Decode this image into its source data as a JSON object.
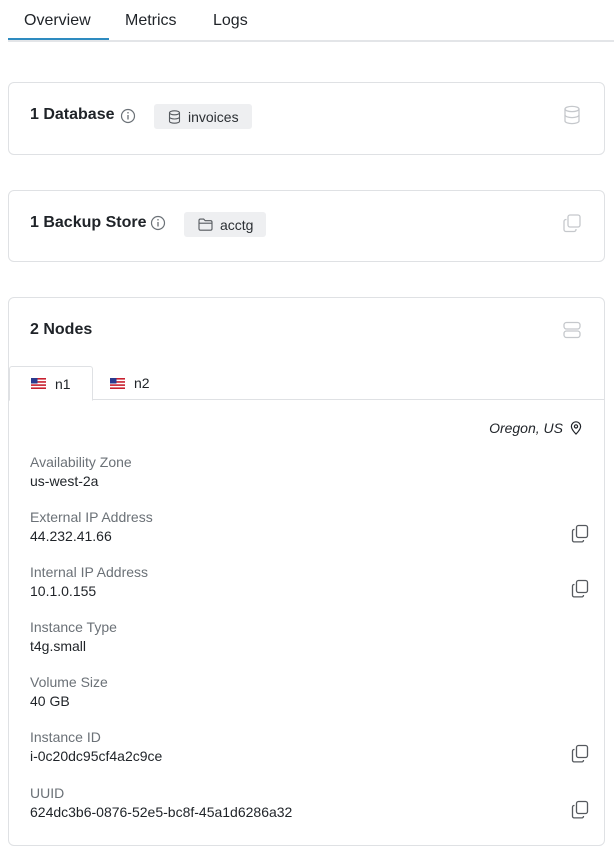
{
  "tabs": [
    {
      "label": "Overview",
      "active": true
    },
    {
      "label": "Metrics",
      "active": false
    },
    {
      "label": "Logs",
      "active": false
    }
  ],
  "colors": {
    "accent": "#2e8bc0",
    "border": "#dfe1e4",
    "muted": "#6b7177",
    "chip_bg": "#eeeff1"
  },
  "databases": {
    "title": "1 Database",
    "info_icon": "info-icon",
    "chip": {
      "icon": "database-icon",
      "label": "invoices"
    },
    "corner_icon": "database-icon"
  },
  "backups": {
    "title": "1 Backup Store",
    "info_icon": "info-icon",
    "chip": {
      "icon": "folder-icon",
      "label": "acctg"
    },
    "corner_icon": "copy-stack-icon"
  },
  "nodes": {
    "title": "2 Nodes",
    "corner_icon": "server-icon",
    "tabs": [
      {
        "label": "n1",
        "flag": "us-flag",
        "active": true
      },
      {
        "label": "n2",
        "flag": "us-flag",
        "active": false
      }
    ],
    "location": "Oregon, US",
    "fields": [
      {
        "label": "Availability Zone",
        "value": "us-west-2a",
        "copyable": false
      },
      {
        "label": "External IP Address",
        "value": "44.232.41.66",
        "copyable": true
      },
      {
        "label": "Internal IP Address",
        "value": "10.1.0.155",
        "copyable": true
      },
      {
        "label": "Instance Type",
        "value": "t4g.small",
        "copyable": false
      },
      {
        "label": "Volume Size",
        "value": "40 GB",
        "copyable": false
      },
      {
        "label": "Instance ID",
        "value": "i-0c20dc95cf4a2c9ce",
        "copyable": true
      },
      {
        "label": "UUID",
        "value": "624dc3b6-0876-52e5-bc8f-45a1d6286a32",
        "copyable": true
      }
    ]
  }
}
